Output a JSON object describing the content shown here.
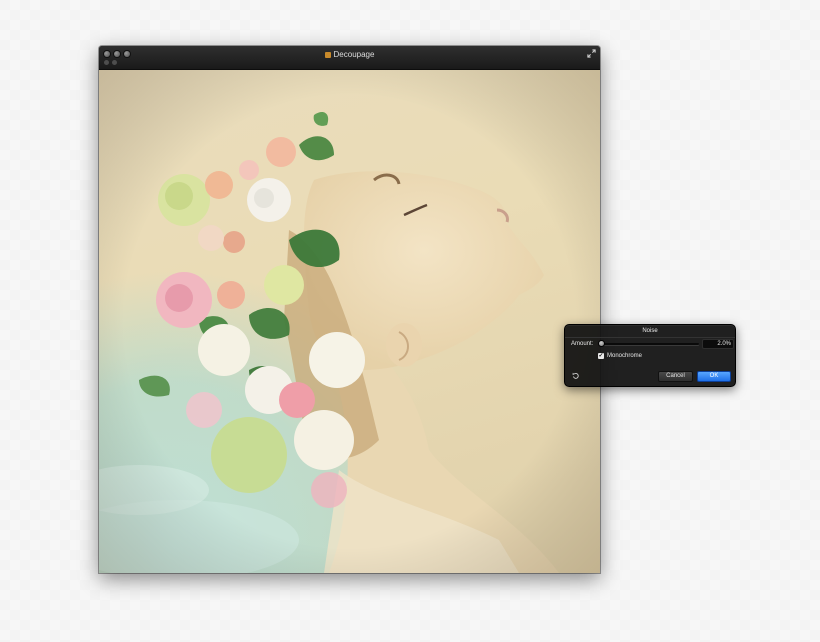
{
  "window": {
    "title": "Decoupage"
  },
  "noise_panel": {
    "title": "Noise",
    "amount_label": "Amount:",
    "amount_value": "2.0%",
    "amount_level_percent": 2.0,
    "monochrome_label": "Monochrome",
    "monochrome_checked": true,
    "cancel_label": "Cancel",
    "ok_label": "OK"
  },
  "colors": {
    "accent": "#2a7ef0",
    "hud_background": "#121212",
    "titlebar": "#222222"
  },
  "icons": {
    "fullscreen": "fullscreen-arrows-icon",
    "reset": "reset-arrow-icon",
    "title": "document-icon"
  }
}
